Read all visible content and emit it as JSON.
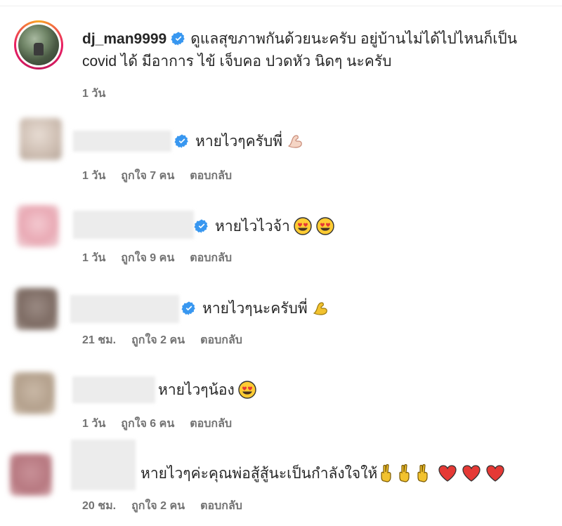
{
  "post": {
    "username": "dj_man9999",
    "caption_line1": "ดูแลสุขภาพกันด้วยนะครับ อยู่บ้านไม่ได้ไปไหนก็เป็น",
    "caption_line2": "covid ได้ มีอาการ ไข้ เจ็บคอ ปวดหัว นิดๆ นะครับ",
    "time": "1 วัน"
  },
  "comments": [
    {
      "text": "หายไวๆครับพี่",
      "time": "1 วัน",
      "likes": "ถูกใจ 7 คน",
      "reply": "ตอบกลับ",
      "verified": true,
      "emojis": [
        "flexed-biceps-light"
      ]
    },
    {
      "text": "หายไวไวจ้า",
      "time": "1 วัน",
      "likes": "ถูกใจ 9 คน",
      "reply": "ตอบกลับ",
      "verified": true,
      "emojis": [
        "heart-eyes",
        "heart-eyes"
      ]
    },
    {
      "text": "หายไวๆนะครับพี่",
      "time": "21 ชม.",
      "likes": "ถูกใจ 2 คน",
      "reply": "ตอบกลับ",
      "verified": true,
      "emojis": [
        "flexed-biceps-yellow"
      ]
    },
    {
      "text": "หายไวๆน้อง",
      "time": "1 วัน",
      "likes": "ถูกใจ 6 คน",
      "reply": "ตอบกลับ",
      "verified": false,
      "emojis": [
        "heart-eyes"
      ]
    },
    {
      "text": "หายไวๆค่ะคุณพ่อสู้สู้นะเป็นกำลังใจให้",
      "time": "20 ชม.",
      "likes": "ถูกใจ 2 คน",
      "reply": "ตอบกลับ",
      "verified": false,
      "emojis": [
        "victory-hand",
        "victory-hand",
        "victory-hand",
        "red-heart",
        "red-heart",
        "red-heart"
      ]
    }
  ],
  "colors": {
    "verified_blue": "#3897f0",
    "meta_gray": "#737373",
    "text": "#262626"
  }
}
